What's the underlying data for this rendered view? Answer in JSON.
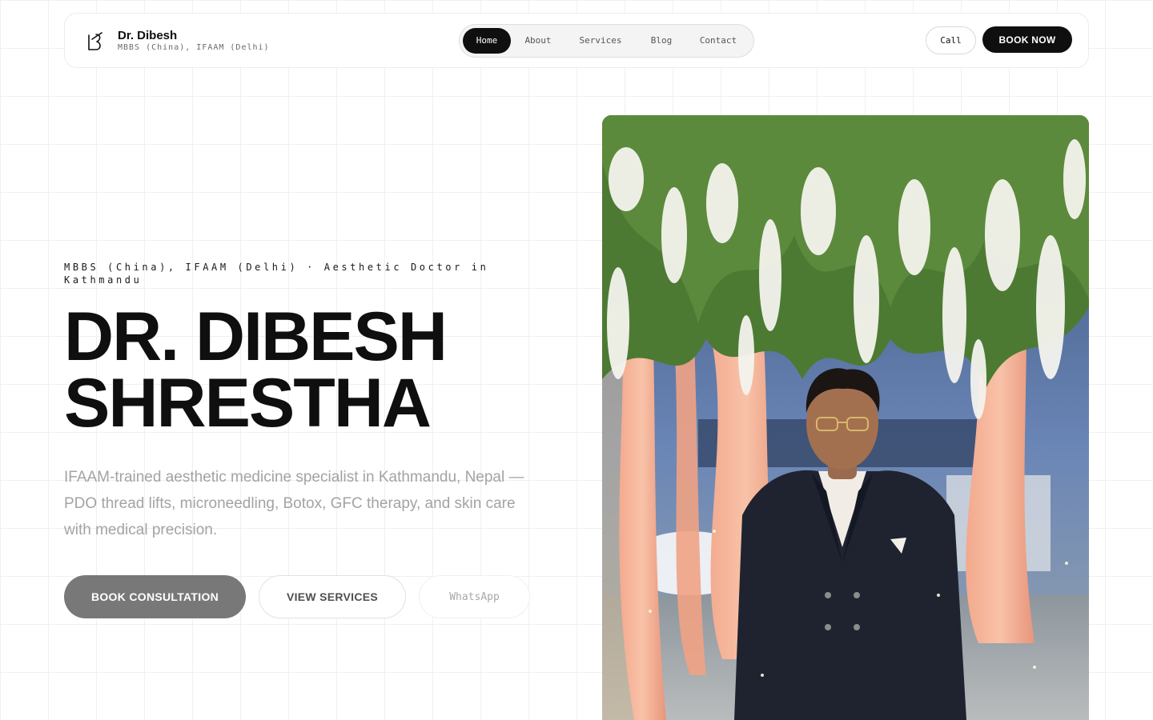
{
  "brand": {
    "name": "Dr. Dibesh",
    "subtitle": "MBBS (China), IFAAM (Delhi)",
    "logo_icon": "monogram-icon"
  },
  "nav": {
    "items": [
      {
        "label": "Home",
        "active": true
      },
      {
        "label": "About",
        "active": false
      },
      {
        "label": "Services",
        "active": false
      },
      {
        "label": "Blog",
        "active": false
      },
      {
        "label": "Contact",
        "active": false
      }
    ]
  },
  "header_actions": {
    "call_label": "Call",
    "book_label": "BOOK NOW"
  },
  "hero": {
    "eyebrow": "MBBS (China), IFAAM (Delhi) · Aesthetic Doctor in Kathmandu",
    "title_line1": "DR. DIBESH",
    "title_line2": "SHRESTHA",
    "description": "IFAAM-trained aesthetic medicine specialist in Kathmandu, Nepal — PDO thread lifts, microneedling, Botox, GFC therapy, and skin care with medical precision.",
    "buttons": {
      "primary": "BOOK CONSULTATION",
      "secondary": "VIEW SERVICES",
      "tertiary": "WhatsApp"
    }
  },
  "colors": {
    "ink": "#0f0f0f",
    "muted": "#a3a3a3",
    "primary_button": "#787878",
    "grid": "#f0f0f0"
  }
}
